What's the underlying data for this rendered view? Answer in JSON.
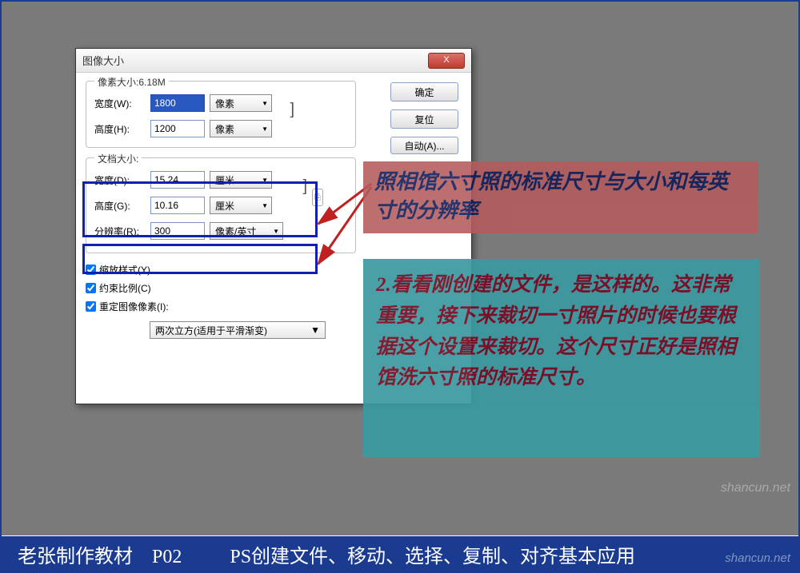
{
  "dialog": {
    "title": "图像大小",
    "pixelDimLegend": "像素大小:6.18M",
    "widthLabel": "宽度(W):",
    "widthValue": "1800",
    "widthUnit": "像素",
    "heightLabel": "高度(H):",
    "heightValue": "1200",
    "heightUnit": "像素",
    "docSizeLegend": "文档大小:",
    "docWidthLabel": "宽度(D):",
    "docWidthValue": "15.24",
    "docWidthUnit": "厘米",
    "docHeightLabel": "高度(G):",
    "docHeightValue": "10.16",
    "docHeightUnit": "厘米",
    "resLabel": "分辨率(R):",
    "resValue": "300",
    "resUnit": "像素/英寸",
    "scaleStylesLabel": "缩放样式(Y)",
    "constrainLabel": "约束比例(C)",
    "resampleLabel": "重定图像像素(I):",
    "interpolation": "两次立方(适用于平滑渐变)",
    "okBtn": "确定",
    "resetBtn": "复位",
    "autoBtn": "自动(A)...",
    "closeX": "X"
  },
  "annotations": {
    "red": "照相馆六寸照的标准尺寸与大小和每英寸的分辨率",
    "teal": "2.看看刚创建的文件，是这样的。这非常重要，接下来裁切一寸照片的时候也要根据这个设置来裁切。这个尺寸正好是照相馆洗六寸照的标准尺寸。"
  },
  "footer": {
    "left": "老张制作教材　P02",
    "right": "PS创建文件、移动、选择、复制、对齐基本应用"
  },
  "watermark": "shancun.net"
}
